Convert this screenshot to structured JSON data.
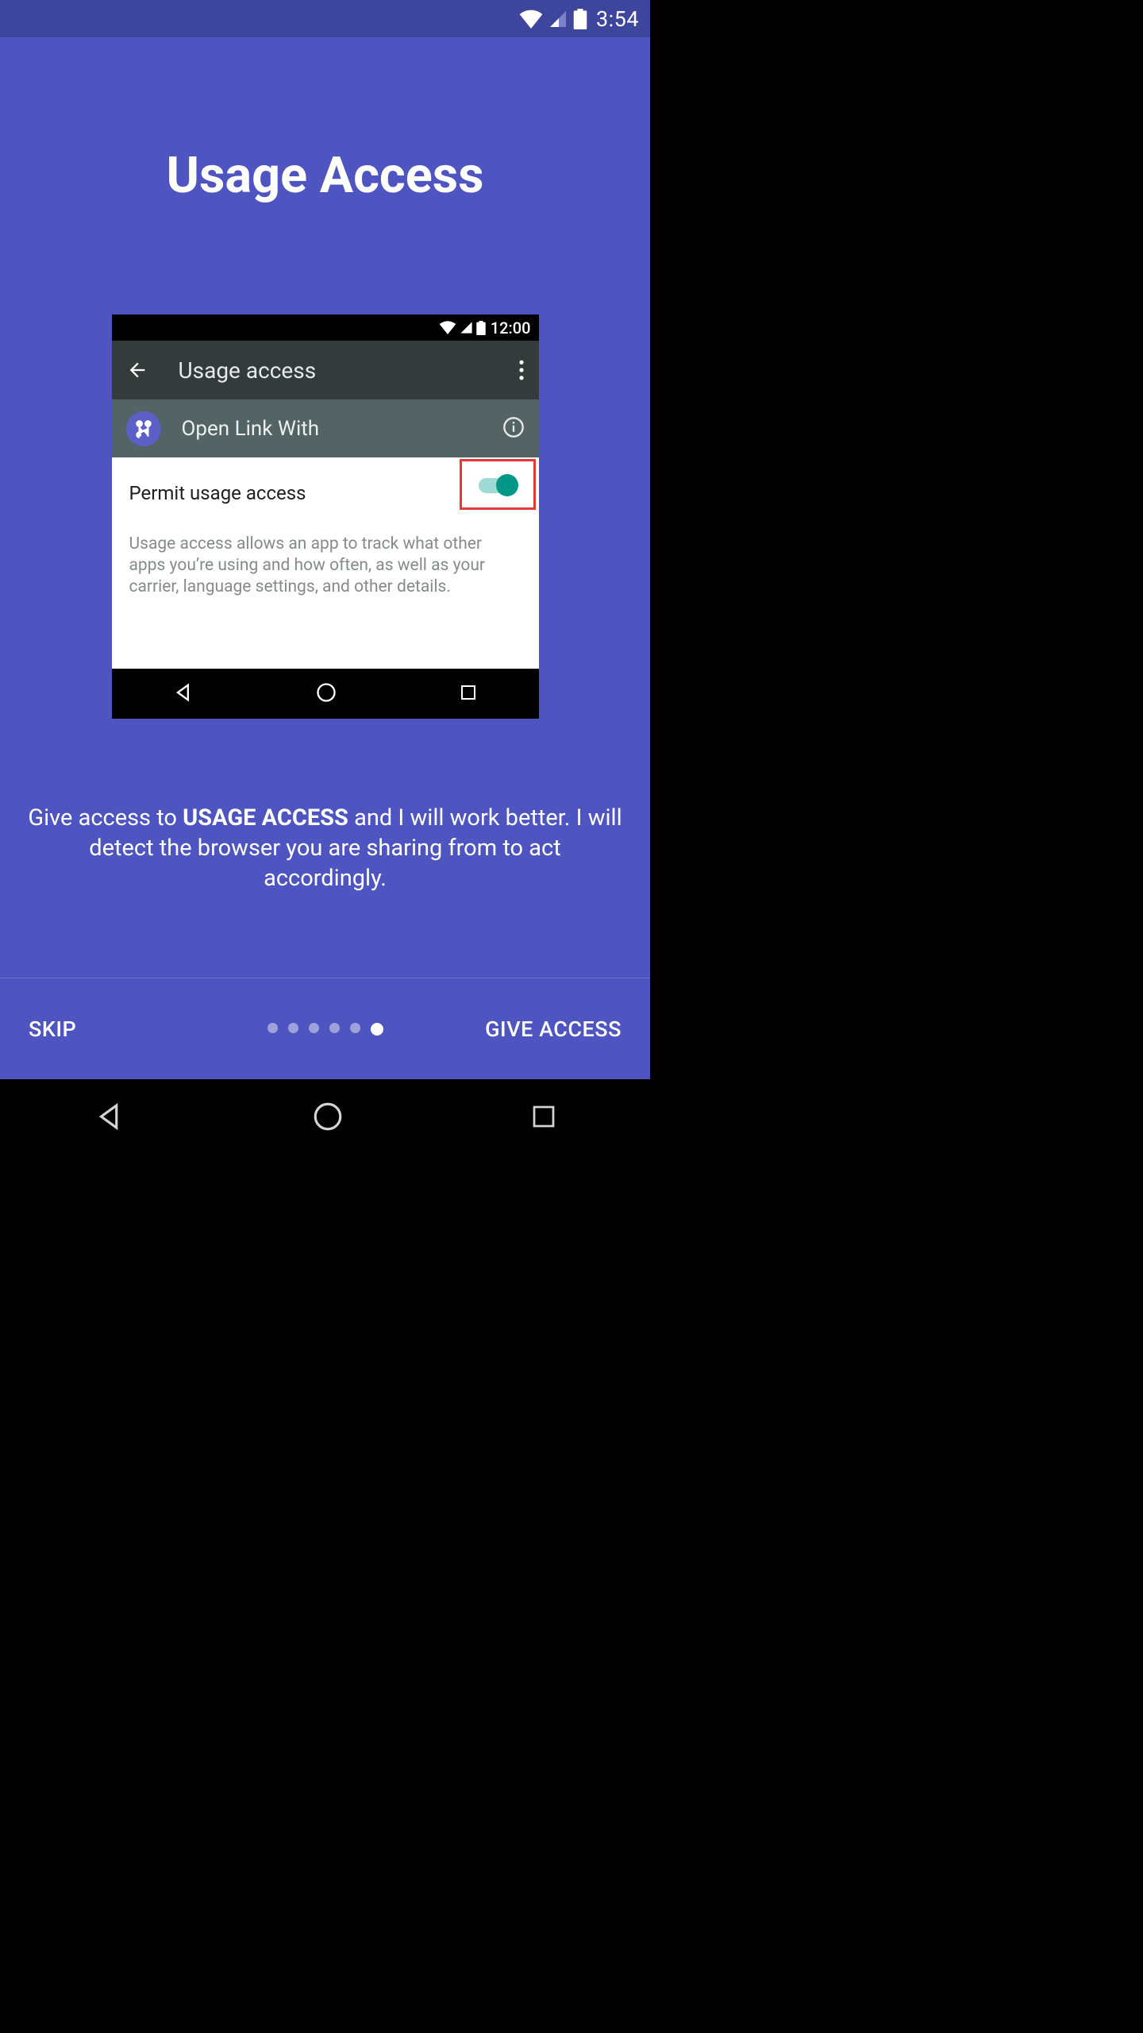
{
  "device_status": {
    "clock": "3:54"
  },
  "onboarding": {
    "title": "Usage Access",
    "description_pre": "Give access to ",
    "description_strong": "USAGE ACCESS",
    "description_post": " and I will work better. I will detect the browser you are sharing from to act accordingly.",
    "skip_label": "SKIP",
    "cta_label": "GIVE ACCESS",
    "dots_total": 6,
    "dots_active_index": 5
  },
  "mock": {
    "status_clock": "12:00",
    "toolbar_title": "Usage access",
    "app_name": "Open Link With",
    "permit_label": "Permit usage access",
    "permit_toggle_on": true,
    "description": "Usage access allows an app to track what other apps you’re using and how often, as well as your carrier, language settings, and other details."
  }
}
